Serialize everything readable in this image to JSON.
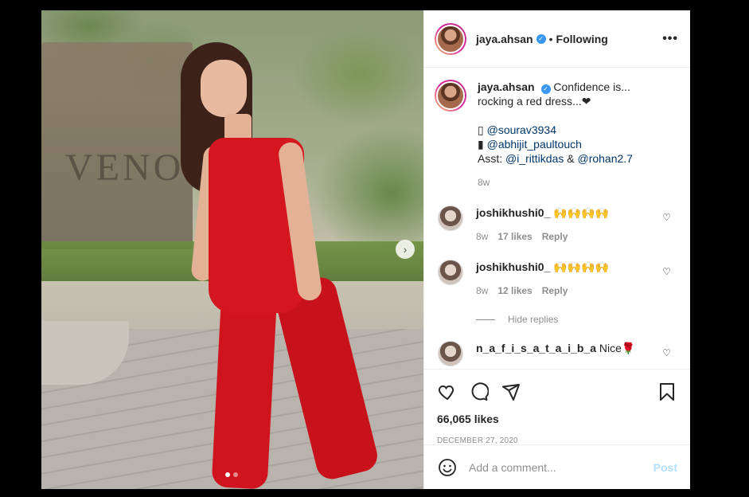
{
  "post": {
    "username": "jaya.ahsan",
    "separator": "•",
    "follow_status": "Following",
    "more_icon": "more-options-icon",
    "photo_bg_text": "VENO",
    "carousel": {
      "current": 1,
      "total": 2
    }
  },
  "caption": {
    "username": "jaya.ahsan",
    "text": "Confidence is... rocking a red dress...❤",
    "line1_icon": "▯",
    "line1_handle": "@sourav3934",
    "line2_icon": "▮",
    "line2_handle": "@abhijit_paultouch",
    "asst_label": "Asst:",
    "asst_handle1": "@i_rittikdas",
    "asst_amp": "&",
    "asst_handle2": "@rohan2.7",
    "time": "8w"
  },
  "comments": [
    {
      "username": "joshikhushi0_",
      "text": "🙌🙌🙌🙌",
      "time": "8w",
      "likes": "17 likes",
      "reply": "Reply"
    },
    {
      "username": "joshikhushi0_",
      "text": "🙌🙌🙌🙌",
      "time": "8w",
      "likes": "12 likes",
      "reply": "Reply"
    },
    {
      "username": "n_a_f_i_s_a_t_a_i_b_a",
      "text": "Nice🌹"
    }
  ],
  "hide_replies": "Hide replies",
  "actions": {
    "likes": "66,065 likes",
    "date": "DECEMBER 27, 2020"
  },
  "add_comment": {
    "placeholder": "Add a comment...",
    "post_label": "Post"
  },
  "colors": {
    "verified": "#3897f0",
    "link": "#00376b",
    "post_disabled": "#b2dffc",
    "dress": "#d4161f"
  }
}
